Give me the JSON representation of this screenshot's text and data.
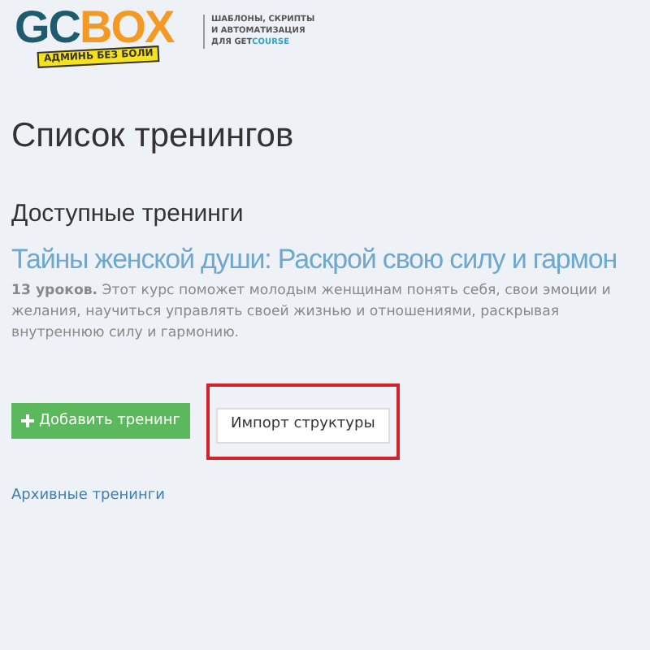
{
  "logo": {
    "mark_left": "GC",
    "mark_right": "BOX",
    "ribbon": "АДМИНЬ БЕЗ БОЛИ",
    "tagline_lines": [
      "ШАБЛОНЫ, СКРИПТЫ",
      "И АВТОМАТИЗАЦИЯ"
    ],
    "tagline_last": "ДЛЯ GET",
    "tagline_brand": "COURSE"
  },
  "page_title": "Список тренингов",
  "section_title": "Доступные тренинги",
  "trainings": [
    {
      "title": "Тайны женской души: Раскрой свою силу и гармон",
      "description": "**13 уроков.** Этот курс поможет молодым женщинам понять себя, свои эмоции и желания, научиться управлять своей жизнью и отношениями, раскрывая внутреннюю силу и гармонию."
    }
  ],
  "buttons": [
    {
      "kind": "primary",
      "label": "Добавить тренинг",
      "highlighted": false
    },
    {
      "kind": "default",
      "label": "Импорт структуры",
      "highlighted": true
    }
  ],
  "archive_link": "Архивные тренинги"
}
